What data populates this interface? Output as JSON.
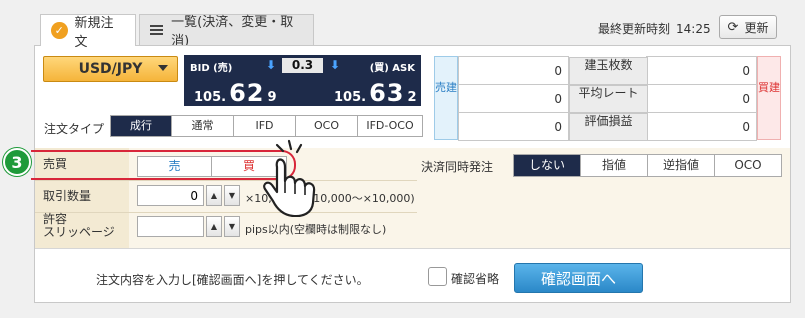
{
  "tabs": [
    {
      "label": "新規注文",
      "icon": "check-circle-icon",
      "active": true
    },
    {
      "label": "一覧(決済、変更・取消)",
      "icon": "list-icon",
      "active": false
    }
  ],
  "header": {
    "last_updated_label": "最終更新時刻",
    "last_updated_time": "14:25",
    "refresh_label": "更新"
  },
  "symbol": {
    "value": "USD/JPY"
  },
  "board": {
    "bid_label": "BID (売)",
    "ask_label": "(買) ASK",
    "spread": "0.3",
    "bid": {
      "prefix": "105.",
      "big": "62",
      "sub": "9"
    },
    "ask": {
      "prefix": "105.",
      "big": "63",
      "sub": "2"
    }
  },
  "order_type": {
    "label": "注文タイプ",
    "options": [
      "成行",
      "通常",
      "IFD",
      "OCO",
      "IFD-OCO"
    ],
    "selected": "成行"
  },
  "positions": {
    "sell_label": "売建",
    "buy_label": "買建",
    "rows": [
      {
        "sell": "0",
        "label": "建玉枚数",
        "buy": "0"
      },
      {
        "sell": "0",
        "label": "平均レート",
        "buy": "0"
      },
      {
        "sell": "0",
        "label": "評価損益",
        "buy": "0"
      }
    ]
  },
  "form": {
    "side_label": "売買",
    "sell": "売",
    "buy": "買",
    "quantity_label": "取引数量",
    "quantity_value": "0",
    "quantity_hint": "×10,000(1×10,000～×10,000)",
    "slippage_label_1": "許容",
    "slippage_label_2": "スリッページ",
    "slippage_value": "",
    "slippage_hint": "pips以内(空欄時は制限なし)",
    "close_label": "決済同時発注",
    "close_options": [
      "しない",
      "指値",
      "逆指値",
      "OCO"
    ],
    "close_selected": "しない"
  },
  "footer": {
    "instruction": "注文内容を入力し[確認画面へ]を押してください。",
    "skip_confirm_label": "確認省略",
    "confirm_button": "確認画面へ"
  },
  "overlay": {
    "step_number": "3"
  },
  "colors": {
    "navy": "#1e2b4a",
    "accent_orange": "#f5b43a",
    "sell_blue": "#2b7fc4",
    "buy_red": "#d33",
    "step_green": "#1f9a3a",
    "highlight_red": "#d8263a"
  }
}
